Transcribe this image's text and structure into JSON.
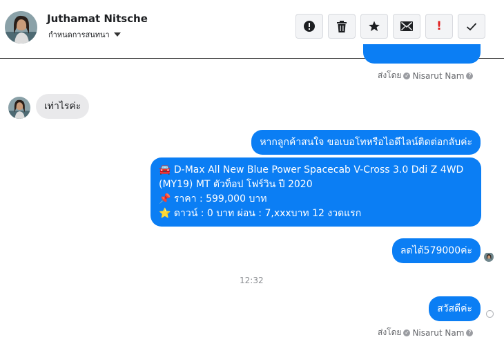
{
  "header": {
    "contact_name": "Juthamat Nitsche",
    "assign_label": "กำหนดการสนทนา",
    "tools": [
      {
        "name": "report-icon"
      },
      {
        "name": "trash-icon"
      },
      {
        "name": "star-icon"
      },
      {
        "name": "mail-icon"
      },
      {
        "name": "important-icon",
        "label": "!"
      },
      {
        "name": "check-icon"
      }
    ]
  },
  "conversation": {
    "sent_by_1": {
      "prefix": "ส่งโดย",
      "name": "Nisarut Nam"
    },
    "msg_customer": "เท่าไรค่ะ",
    "msg_reply_1": "หากลูกค้าสนใจ ขอเบอโทหรือไอดีไลน์ติดต่อกลับค่ะ",
    "msg_offer": {
      "line1": "🚘 D-Max All New Blue Power Spacecab V-Cross 3.0 Ddi Z 4WD",
      "line2": "(MY19) MT ตัวท็อป โฟร์วิน ปี 2020",
      "line3": "📌 ราคา : 599,000 บาท",
      "line4": "⭐ ดาวน์ : 0 บาท ผ่อน : 7,xxxบาท 12 งวดแรก"
    },
    "msg_discount": "ลดได้579000ค่ะ",
    "timestamp": "12:32",
    "msg_greeting": "สวัสดีค่ะ",
    "sent_by_2": {
      "prefix": "ส่งโดย",
      "name": "Nisarut Nam"
    }
  }
}
